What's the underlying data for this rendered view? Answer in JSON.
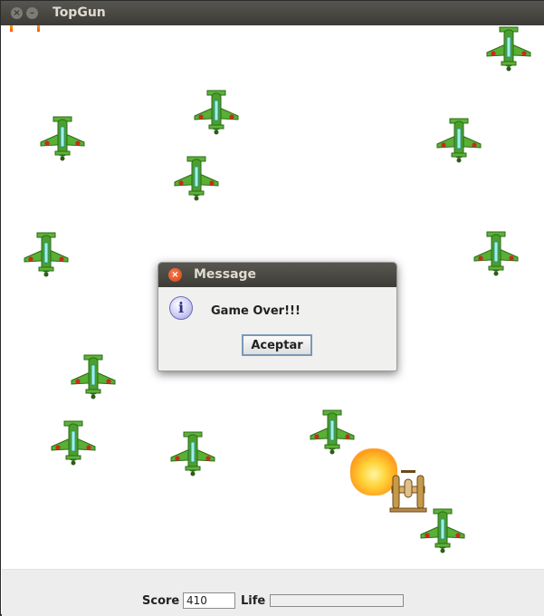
{
  "window": {
    "title": "TopGun"
  },
  "dialog": {
    "title": "Message",
    "message": "Game Over!!!",
    "button_label": "Aceptar",
    "icon": "info-icon"
  },
  "status": {
    "score_label": "Score",
    "score_value": "410",
    "life_label": "Life",
    "life_fraction": 0
  },
  "colors": {
    "enemy_body": "#4aa02c",
    "player_body": "#c69a4a",
    "explosion": "#ffb629"
  }
}
